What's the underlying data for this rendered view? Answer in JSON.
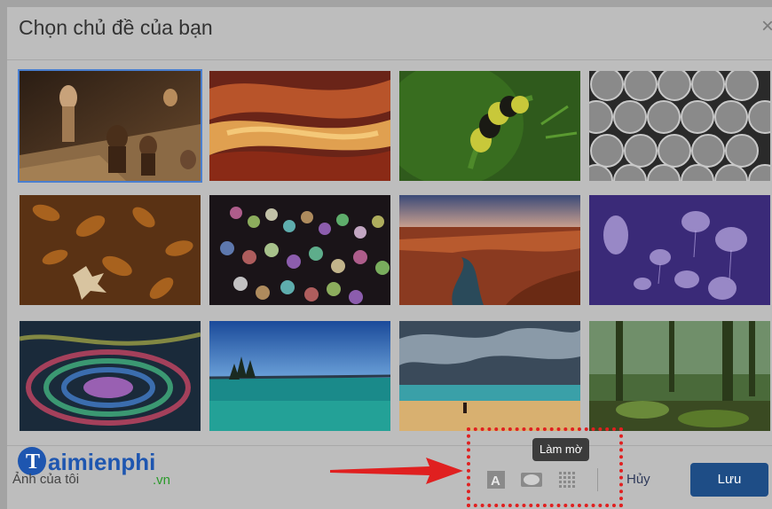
{
  "dialog": {
    "title": "Chọn chủ đề của bạn",
    "close_symbol": "×"
  },
  "themes": [
    {
      "name": "chess"
    },
    {
      "name": "canyon-waves"
    },
    {
      "name": "caterpillar"
    },
    {
      "name": "pipes"
    },
    {
      "name": "autumn-leaves"
    },
    {
      "name": "bokeh-lights"
    },
    {
      "name": "canyon-river"
    },
    {
      "name": "jellyfish"
    },
    {
      "name": "colorful-ripple"
    },
    {
      "name": "lake-shore"
    },
    {
      "name": "beach"
    },
    {
      "name": "forest"
    }
  ],
  "footer": {
    "logo_text": "aimienphi",
    "logo_letter": "T",
    "logo_suffix": ".vn",
    "my_photos": "Ảnh của tôi",
    "tooltip": "Làm mờ",
    "text_bg_button": "A",
    "cancel_label": "Hủy",
    "save_label": "Lưu"
  },
  "colors": {
    "accent": "#1e4d86",
    "highlight": "#e02020",
    "selection": "#4a7fcf"
  }
}
